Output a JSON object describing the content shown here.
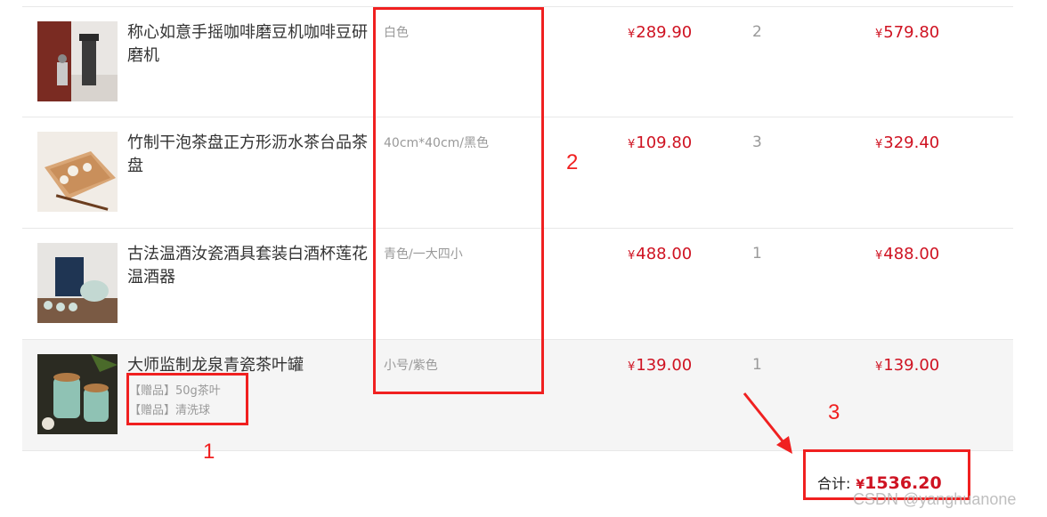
{
  "currency_symbol": "¥",
  "items": [
    {
      "name": "称心如意手摇咖啡磨豆机咖啡豆研磨机",
      "spec": "白色",
      "price": "289.90",
      "qty": "2",
      "subtotal": "579.80"
    },
    {
      "name": "竹制干泡茶盘正方形沥水茶台品茶盘",
      "spec": "40cm*40cm/黑色",
      "price": "109.80",
      "qty": "3",
      "subtotal": "329.40"
    },
    {
      "name": "古法温酒汝瓷酒具套装白酒杯莲花温酒器",
      "spec": "青色/一大四小",
      "price": "488.00",
      "qty": "1",
      "subtotal": "488.00"
    },
    {
      "name": "大师监制龙泉青瓷茶叶罐",
      "spec": "小号/紫色",
      "price": "139.00",
      "qty": "1",
      "subtotal": "139.00",
      "gifts": [
        {
          "tag": "【赠品】",
          "text": "50g茶叶"
        },
        {
          "tag": "【赠品】",
          "text": "清洗球"
        }
      ]
    }
  ],
  "total": {
    "label": "合计:",
    "amount": "1536.20"
  },
  "annotations": {
    "n1": "1",
    "n2": "2",
    "n3": "3",
    "color": "#f02020"
  },
  "watermark": "CSDN @yanghuanone",
  "colors": {
    "price": "#cf1322",
    "muted": "#999999",
    "row_highlight": "#f5f5f5"
  }
}
